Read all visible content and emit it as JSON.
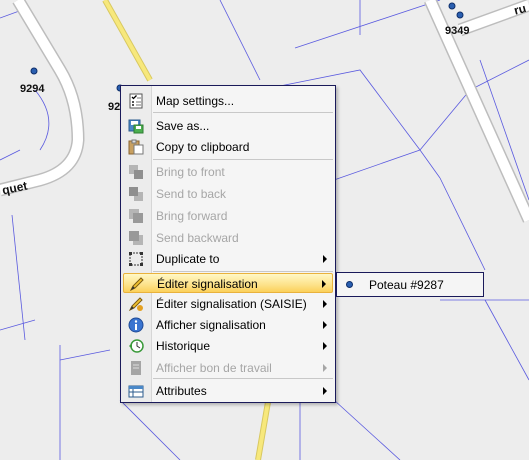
{
  "map": {
    "labels": {
      "p9294": "9294",
      "p9349": "9349",
      "p92": "92",
      "street_quet": "quet",
      "street_r": "ru"
    },
    "colors": {
      "road_yellow": "#f7e87c",
      "road_edge": "#bdbdbd",
      "parcel_line": "#5a5adf"
    }
  },
  "context_menu": {
    "items": [
      {
        "label": "Map settings...",
        "icon": "map-settings-icon",
        "disabled": false,
        "submenu": false
      },
      {
        "label": "Save as...",
        "icon": "save-icon",
        "disabled": false,
        "submenu": false
      },
      {
        "label": "Copy to clipboard",
        "icon": "clipboard-icon",
        "disabled": false,
        "submenu": false
      },
      {
        "label": "Bring to front",
        "icon": "bring-front-icon",
        "disabled": true,
        "submenu": false
      },
      {
        "label": "Send to back",
        "icon": "send-back-icon",
        "disabled": true,
        "submenu": false
      },
      {
        "label": "Bring forward",
        "icon": "bring-forward-icon",
        "disabled": true,
        "submenu": false
      },
      {
        "label": "Send backward",
        "icon": "send-backward-icon",
        "disabled": true,
        "submenu": false
      },
      {
        "label": "Duplicate to",
        "icon": "duplicate-icon",
        "disabled": false,
        "submenu": true
      },
      {
        "label": "Éditer signalisation",
        "icon": "pencil-icon",
        "disabled": false,
        "submenu": true,
        "highlighted": true
      },
      {
        "label": "Éditer signalisation (SAISIE)",
        "icon": "pencil-edit-icon",
        "disabled": false,
        "submenu": true
      },
      {
        "label": "Afficher signalisation",
        "icon": "info-icon",
        "disabled": false,
        "submenu": true
      },
      {
        "label": "Historique",
        "icon": "history-icon",
        "disabled": false,
        "submenu": true
      },
      {
        "label": "Afficher bon de travail",
        "icon": "work-order-icon",
        "disabled": true,
        "submenu": true
      },
      {
        "label": "Attributes",
        "icon": "attributes-table-icon",
        "disabled": false,
        "submenu": true
      }
    ]
  },
  "submenu": {
    "item_label": "Poteau #9287"
  }
}
